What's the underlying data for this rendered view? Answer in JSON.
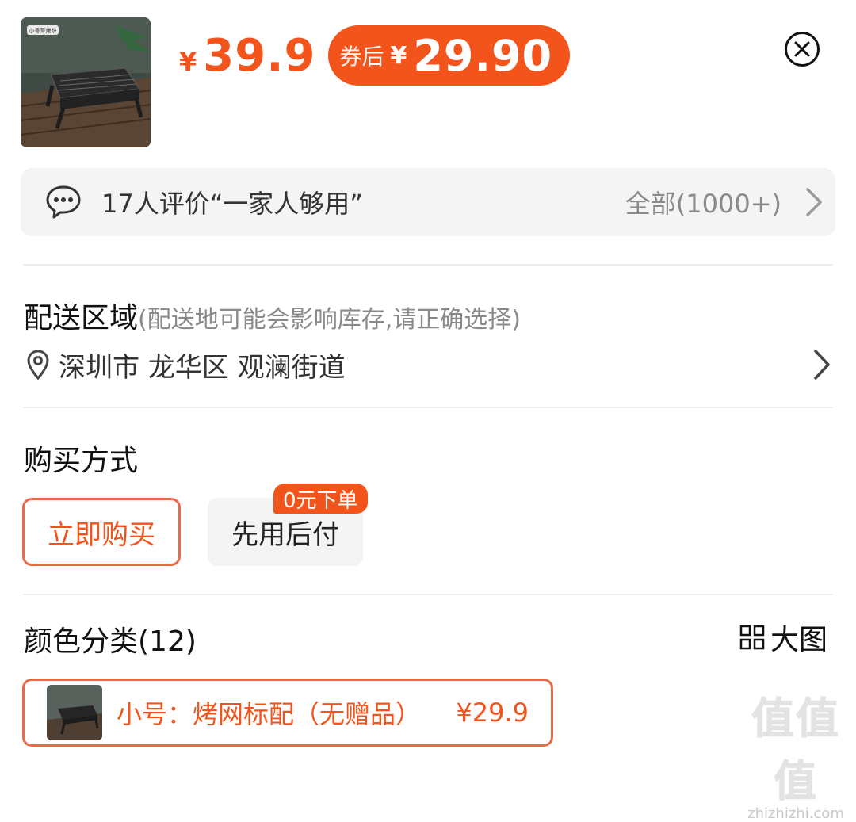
{
  "product": {
    "image_icon": "bbq-grill-image",
    "image_tag": "小号草烤炉",
    "price_currency": "¥",
    "price": "39.9",
    "coupon_label": "券后",
    "coupon_currency": "¥",
    "coupon_price": "29.90"
  },
  "reviews": {
    "summary": "17人评价“一家人够用”",
    "all_label": "全部(1000+)"
  },
  "delivery": {
    "title": "配送区域",
    "hint": "(配送地可能会影响库存,请正确选择)",
    "address": "深圳市 龙华区 观澜街道"
  },
  "purchase": {
    "title": "购买方式",
    "options": [
      {
        "label": "立即购买",
        "selected": true
      },
      {
        "label": "先用后付",
        "selected": false,
        "badge": "0元下单"
      }
    ]
  },
  "color": {
    "title": "颜色分类(12)",
    "bigview_label": "大图",
    "variants": [
      {
        "label": "小号：烤网标配（无赠品）",
        "price": "¥29.9"
      }
    ]
  },
  "watermark": {
    "big": "值值值",
    "small": "zhizhizhi.com"
  },
  "colors": {
    "accent": "#f2541b",
    "border": "#e96a45",
    "panel": "#f4f4f4"
  }
}
